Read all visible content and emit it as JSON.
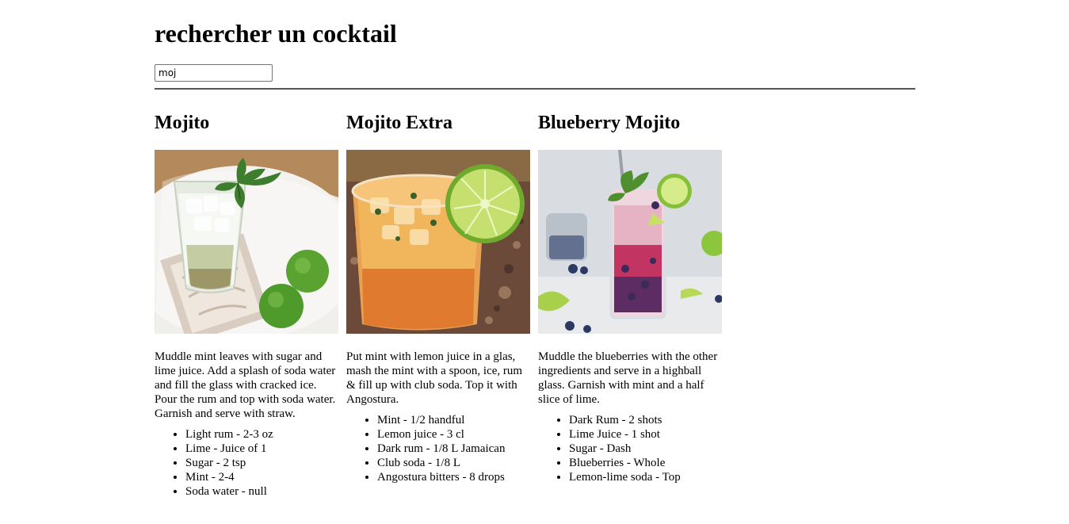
{
  "page": {
    "title": "rechercher un cocktail"
  },
  "search": {
    "value": "moj"
  },
  "results": [
    {
      "name": "Mojito",
      "image_icon": "mojito-photo",
      "instructions": "Muddle mint leaves with sugar and lime juice. Add a splash of soda water and fill the glass with cracked ice. Pour the rum and top with soda water. Garnish and serve with straw.",
      "ingredients": [
        "Light rum - 2-3 oz",
        "Lime - Juice of 1",
        "Sugar - 2 tsp",
        "Mint - 2-4",
        "Soda water - null"
      ]
    },
    {
      "name": "Mojito Extra",
      "image_icon": "mojito-extra-photo",
      "instructions": "Put mint with lemon juice in a glas, mash the mint with a spoon, ice, rum & fill up with club soda. Top it with Angostura.",
      "ingredients": [
        "Mint - 1/2 handful",
        "Lemon juice - 3 cl",
        "Dark rum - 1/8 L Jamaican",
        "Club soda - 1/8 L",
        "Angostura bitters - 8 drops"
      ]
    },
    {
      "name": "Blueberry Mojito",
      "image_icon": "blueberry-mojito-photo",
      "instructions": "Muddle the blueberries with the other ingredients and serve in a highball glass. Garnish with mint and a half slice of lime.",
      "ingredients": [
        "Dark Rum - 2 shots",
        "Lime Juice - 1 shot",
        "Sugar - Dash",
        "Blueberries - Whole",
        "Lemon-lime soda - Top"
      ]
    }
  ]
}
